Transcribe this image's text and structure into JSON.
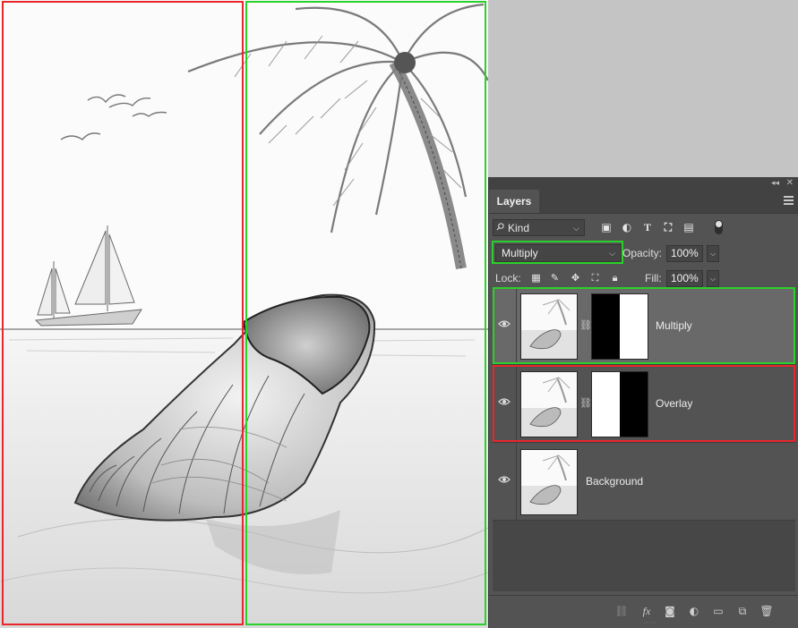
{
  "panel": {
    "tab_label": "Layers",
    "filter": {
      "kind_label": "Kind"
    },
    "blend_mode": "Multiply",
    "opacity_label": "Opacity:",
    "opacity_value": "100%",
    "lock_label": "Lock:",
    "fill_label": "Fill:",
    "fill_value": "100%",
    "layers": [
      {
        "name": "Multiply",
        "visible": true,
        "selected": true,
        "has_mask": true,
        "mask_white_side": "right",
        "outline_color": "#2bd12b"
      },
      {
        "name": "Overlay",
        "visible": true,
        "selected": false,
        "has_mask": true,
        "mask_white_side": "left",
        "outline_color": "#e8262b"
      },
      {
        "name": "Background",
        "visible": true,
        "selected": false,
        "has_mask": false
      }
    ],
    "filter_icons": [
      "image-icon",
      "adjustment-icon",
      "type-icon",
      "shape-icon",
      "smart-object-icon"
    ],
    "lock_icons": [
      "lock-transparent-icon",
      "lock-image-icon",
      "lock-position-icon",
      "lock-artboard-icon",
      "lock-all-icon"
    ],
    "bottom_icons": [
      "link-layers-icon",
      "fx-icon",
      "add-mask-icon",
      "adjustment-layer-icon",
      "group-icon",
      "new-layer-icon",
      "delete-icon"
    ]
  },
  "canvas": {
    "guide_colors": {
      "left": "#e8262b",
      "right": "#2bd12b"
    }
  }
}
